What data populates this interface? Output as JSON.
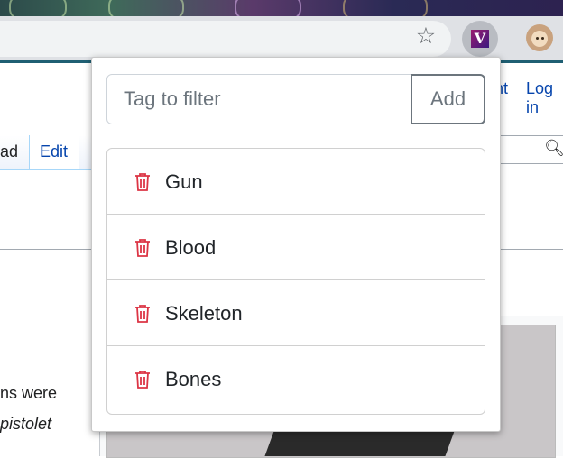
{
  "browser": {
    "bookmark_icon": "star-icon",
    "extension_icon": "tag-filter-extension-icon",
    "extension_glyph": "V",
    "profile_icon": "avatar"
  },
  "background_page": {
    "header_links": [
      "nt",
      "Log in"
    ],
    "tabs": [
      "ad",
      "Edit"
    ],
    "search_icon": "search-icon",
    "text_lines": [
      "ns were",
      "pistolet"
    ]
  },
  "popup": {
    "filter": {
      "placeholder": "Tag to filter",
      "value": "",
      "add_label": "Add"
    },
    "tags": [
      {
        "label": "Gun",
        "icon": "trash-icon"
      },
      {
        "label": "Blood",
        "icon": "trash-icon"
      },
      {
        "label": "Skeleton",
        "icon": "trash-icon"
      },
      {
        "label": "Bones",
        "icon": "trash-icon"
      }
    ],
    "colors": {
      "delete": "#dc3545",
      "button_border": "#6c757d"
    }
  }
}
